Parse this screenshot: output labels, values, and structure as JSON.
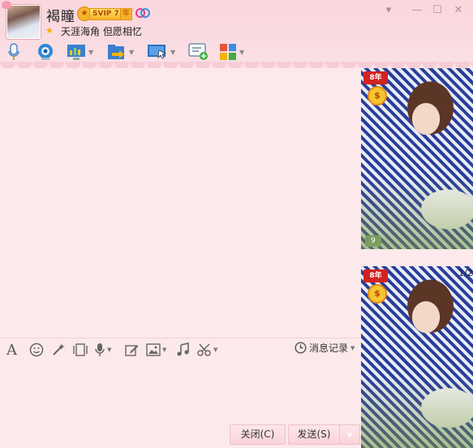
{
  "contact": {
    "name": "褐瞳",
    "svip_label": "SVIP 7",
    "svip_year": "年",
    "signature": "天涯海角 但愿相忆"
  },
  "window_controls": {
    "collapse": "▾",
    "minimize": "—",
    "maximize": "☐",
    "close": "✕"
  },
  "toolbar": {
    "items": [
      {
        "icon": "microphone-icon"
      },
      {
        "icon": "video-call-icon"
      },
      {
        "icon": "remote-desktop-icon"
      },
      {
        "icon": "file-transfer-icon"
      },
      {
        "icon": "screen-share-icon"
      },
      {
        "icon": "new-message-icon"
      },
      {
        "icon": "apps-icon"
      }
    ]
  },
  "format_bar": {
    "history_label": "消息记录"
  },
  "buttons": {
    "close": "关闭(C)",
    "send": "发送(S)"
  },
  "side_panel": {
    "badge_year": "8年",
    "coin": "$",
    "pager": "1/2",
    "thumb_count": "9"
  },
  "colors": {
    "title_bg": "#fbd6dd",
    "pane_bg": "#fce9eb",
    "vip_gold": "#f4b22a"
  }
}
